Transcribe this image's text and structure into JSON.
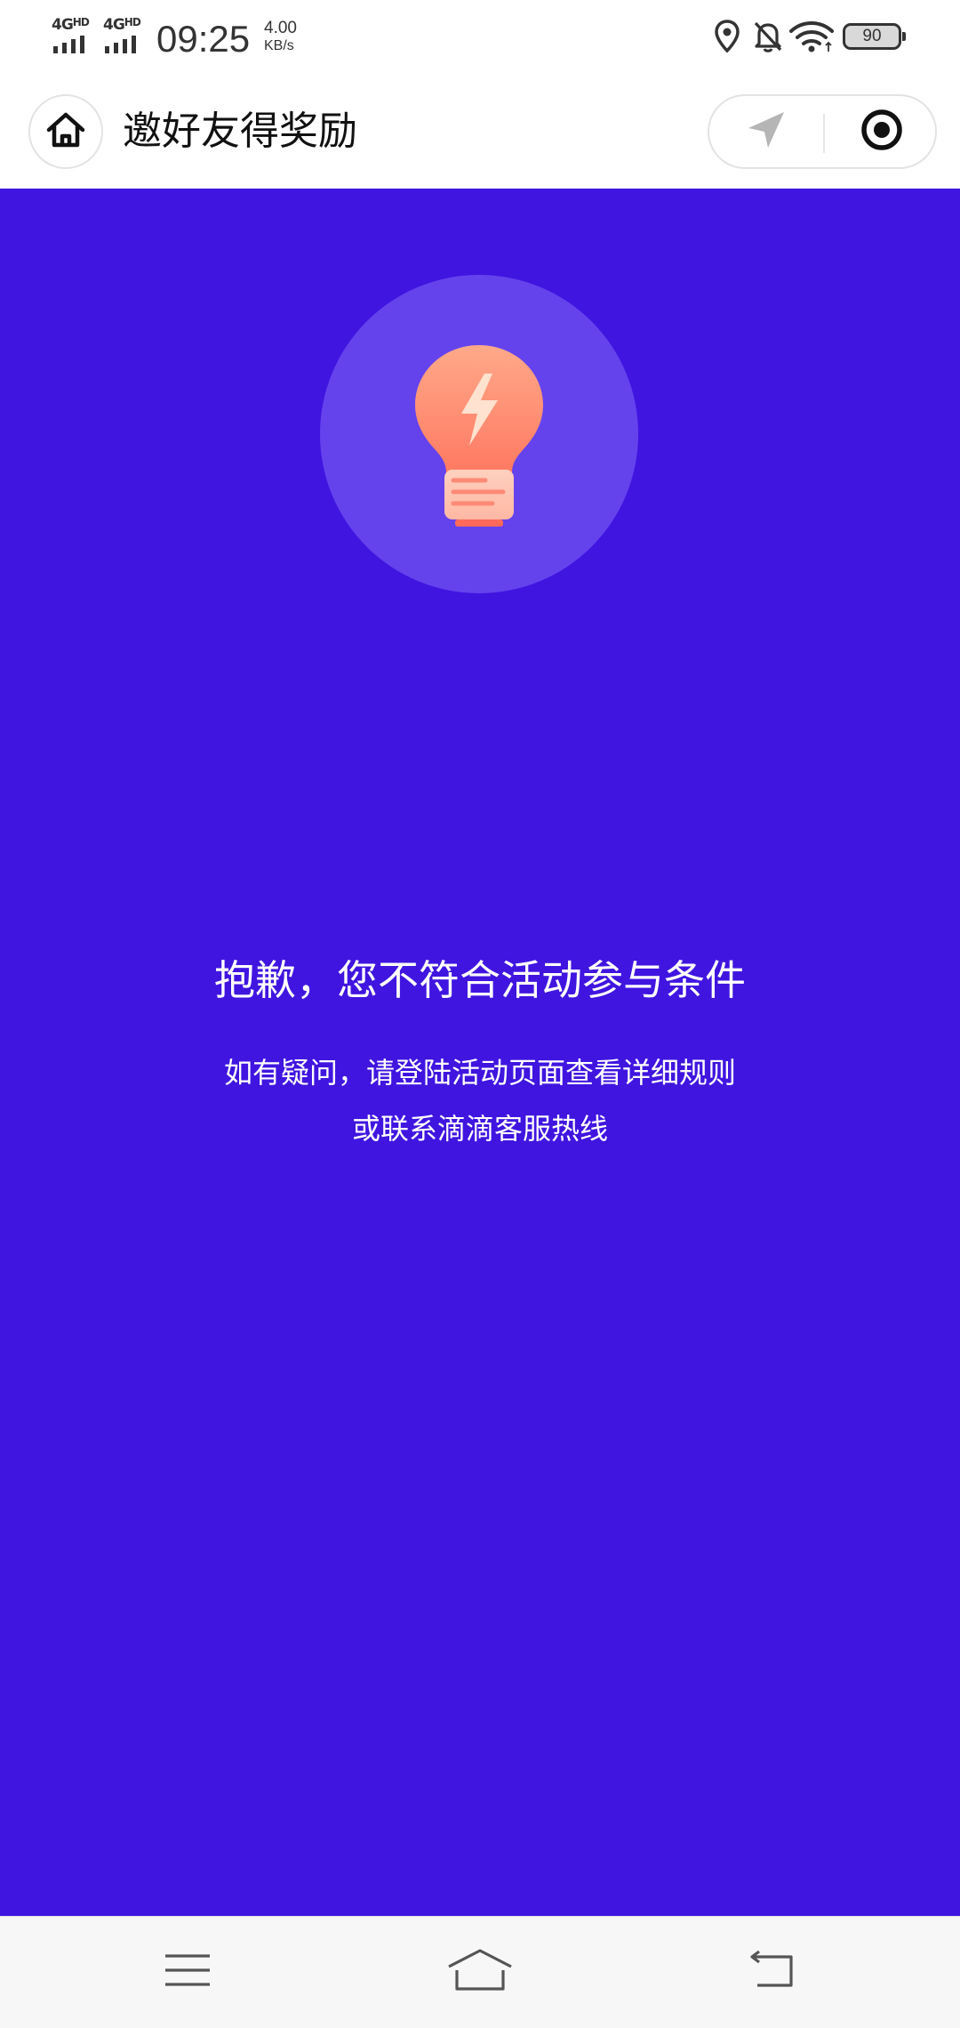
{
  "status_bar": {
    "network_1": "4G",
    "network_1_sup": "HD",
    "network_2": "4G",
    "network_2_sup": "HD",
    "time": "09:25",
    "net_speed_value": "4.00",
    "net_speed_unit": "KB/s",
    "battery": "90",
    "icons": [
      "location-icon",
      "bell-muted-icon",
      "wifi-icon",
      "battery-icon"
    ]
  },
  "title_bar": {
    "title": "邀好友得奖励",
    "home_icon": "home-icon",
    "capsule_icons": [
      "navigation-arrow-icon",
      "record-target-icon"
    ]
  },
  "main": {
    "background_color": "#4015e0",
    "illustration": "lightbulb-icon",
    "headline": "抱歉，您不符合活动参与条件",
    "description_line_1": "如有疑问，请登陆活动页面查看详细规则",
    "description_line_2": "或联系滴滴客服热线"
  },
  "nav_bar": {
    "icons": [
      "menu-icon",
      "nav-home-icon",
      "back-icon"
    ]
  }
}
